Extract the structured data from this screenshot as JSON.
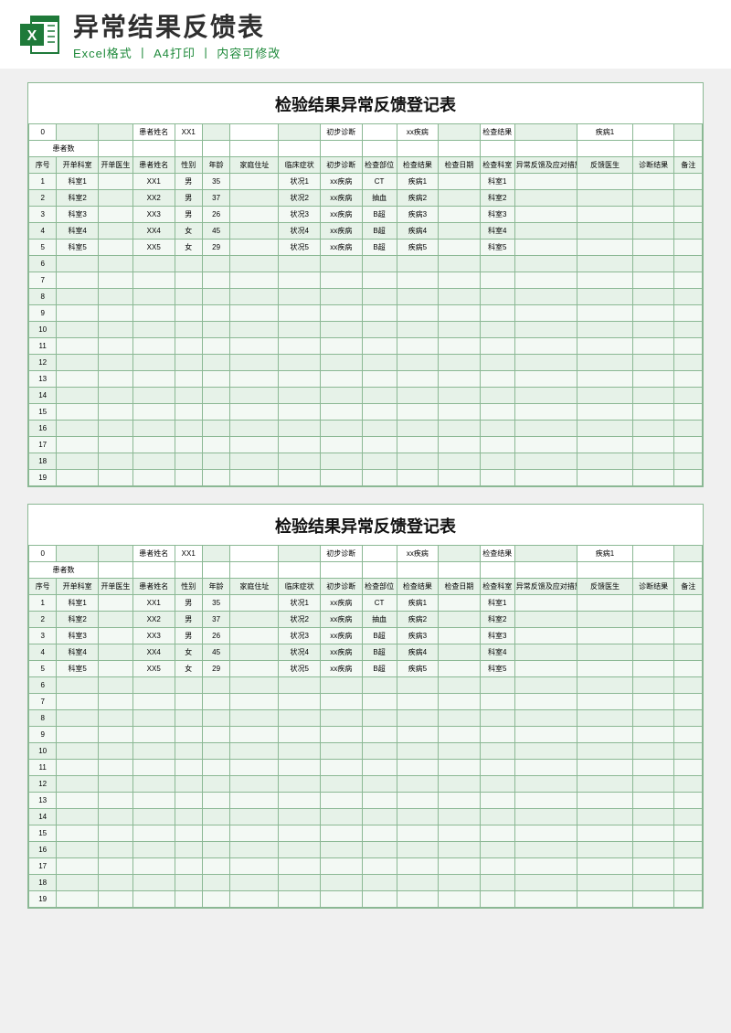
{
  "header": {
    "title": "异常结果反馈表",
    "sub1": "Excel格式",
    "sep": "丨",
    "sub2": "A4打印",
    "sub3": "内容可修改"
  },
  "sheet": {
    "title": "检验结果异常反馈登记表",
    "summary": {
      "l1": "0",
      "l2": "患者姓名",
      "l3": "XX1",
      "l4": "初步诊断",
      "l5": "xx疾病",
      "l6": "检查结果",
      "l7": "疾病1"
    },
    "count_label": "患者数",
    "headers": [
      "序号",
      "开单科室",
      "开单医生",
      "患者姓名",
      "性别",
      "年龄",
      "家庭住址",
      "临床症状",
      "初步诊断",
      "检查部位",
      "检查结果",
      "检查日期",
      "检查科室",
      "异常反馈及应对措施",
      "反馈医生",
      "诊断结果",
      "备注"
    ],
    "rows": [
      {
        "sn": "1",
        "dept": "科室1",
        "doc": "",
        "name": "XX1",
        "sex": "男",
        "age": "35",
        "addr": "",
        "sym": "状况1",
        "diag": "xx疾病",
        "part": "CT",
        "res": "疾病1",
        "date": "",
        "cdept": "科室1",
        "fb": "",
        "fdoc": "",
        "dres": "",
        "note": ""
      },
      {
        "sn": "2",
        "dept": "科室2",
        "doc": "",
        "name": "XX2",
        "sex": "男",
        "age": "37",
        "addr": "",
        "sym": "状况2",
        "diag": "xx疾病",
        "part": "抽血",
        "res": "疾病2",
        "date": "",
        "cdept": "科室2",
        "fb": "",
        "fdoc": "",
        "dres": "",
        "note": ""
      },
      {
        "sn": "3",
        "dept": "科室3",
        "doc": "",
        "name": "XX3",
        "sex": "男",
        "age": "26",
        "addr": "",
        "sym": "状况3",
        "diag": "xx疾病",
        "part": "B超",
        "res": "疾病3",
        "date": "",
        "cdept": "科室3",
        "fb": "",
        "fdoc": "",
        "dres": "",
        "note": ""
      },
      {
        "sn": "4",
        "dept": "科室4",
        "doc": "",
        "name": "XX4",
        "sex": "女",
        "age": "45",
        "addr": "",
        "sym": "状况4",
        "diag": "xx疾病",
        "part": "B超",
        "res": "疾病4",
        "date": "",
        "cdept": "科室4",
        "fb": "",
        "fdoc": "",
        "dres": "",
        "note": ""
      },
      {
        "sn": "5",
        "dept": "科室5",
        "doc": "",
        "name": "XX5",
        "sex": "女",
        "age": "29",
        "addr": "",
        "sym": "状况5",
        "diag": "xx疾病",
        "part": "B超",
        "res": "疾病5",
        "date": "",
        "cdept": "科室5",
        "fb": "",
        "fdoc": "",
        "dres": "",
        "note": ""
      }
    ],
    "empty_start": 6,
    "empty_end": 19
  }
}
